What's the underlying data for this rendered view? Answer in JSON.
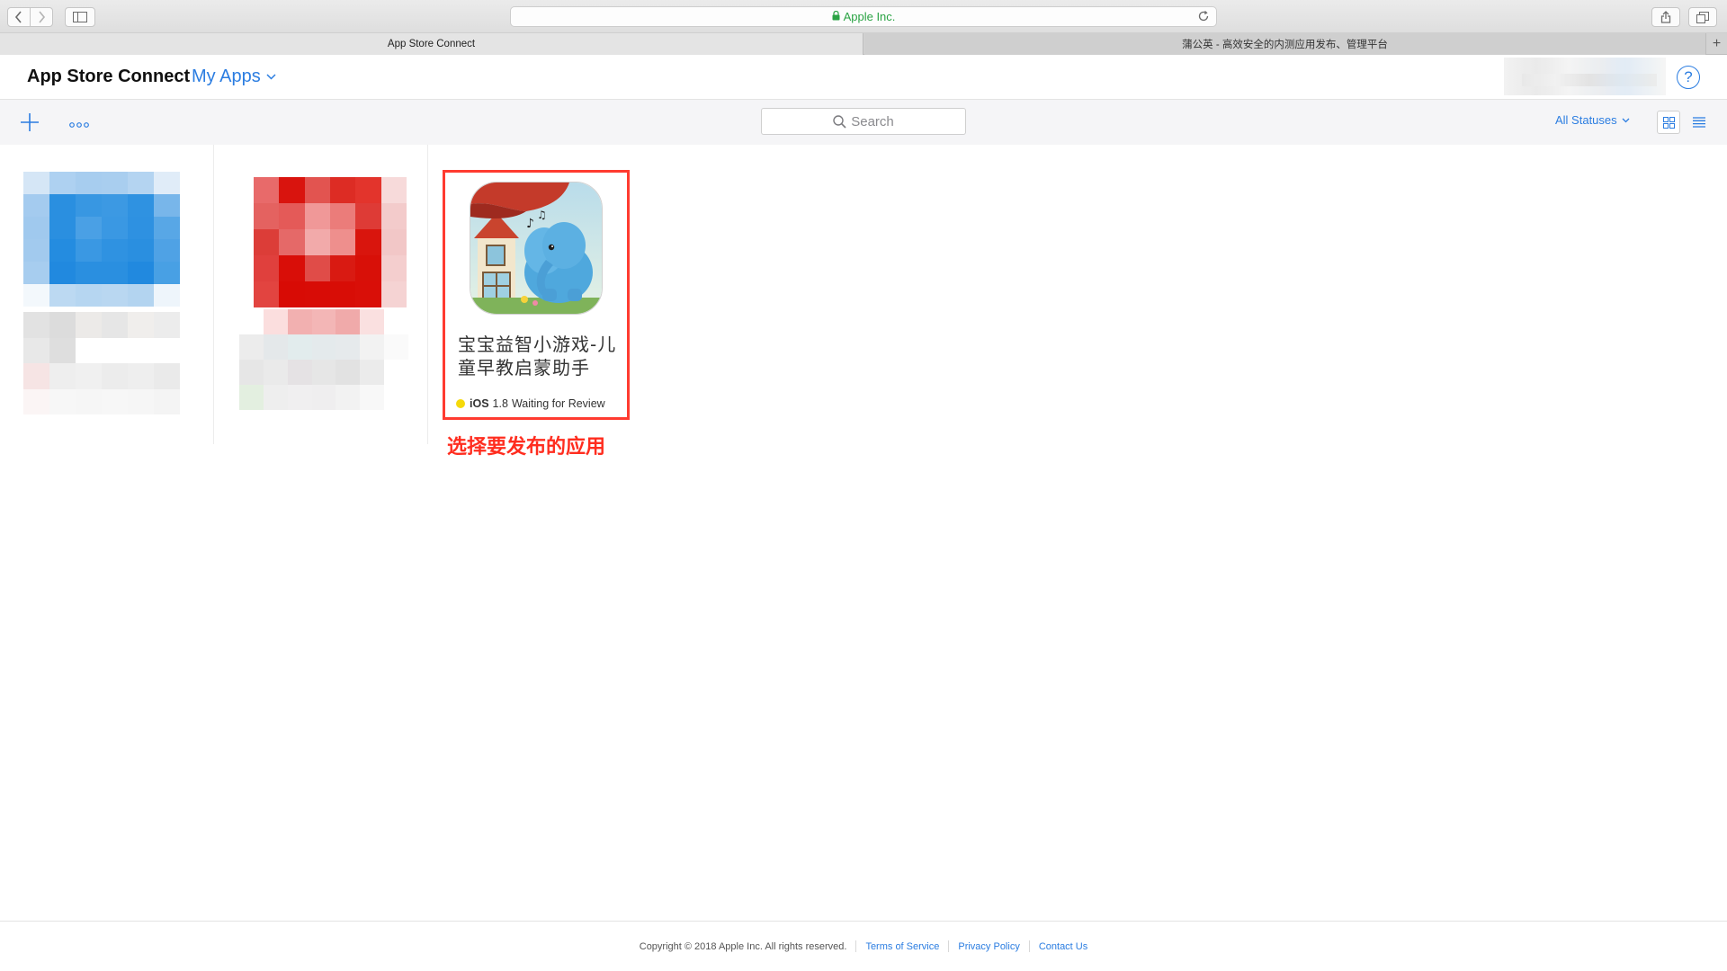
{
  "browser": {
    "address": "Apple Inc.",
    "tabs": [
      {
        "label": "App Store Connect"
      },
      {
        "label": "蒲公英 - 高效安全的内测应用发布、管理平台"
      }
    ],
    "new_tab": "+"
  },
  "header": {
    "brand": "App Store Connect",
    "section": "My Apps",
    "help": "?"
  },
  "subbar": {
    "search_placeholder": "Search",
    "status_filter": "All Statuses"
  },
  "apps": [
    {
      "name": "宝宝益智小游戏-儿童早教启蒙助手",
      "platform": "iOS",
      "version": "1.8",
      "status": "Waiting for Review",
      "status_color": "#f5d90a"
    }
  ],
  "annotation": {
    "caption": "选择要发布的应用",
    "color": "#ff2d1f"
  },
  "footer": {
    "copyright": "Copyright © 2018 Apple Inc. All rights reserved.",
    "links": [
      "Terms of Service",
      "Privacy Policy",
      "Contact Us"
    ]
  },
  "colors": {
    "accent": "#2b7de1",
    "highlight_border": "#ff3b30"
  },
  "icons": [
    "back-icon",
    "forward-icon",
    "sidebar-icon",
    "lock-icon",
    "reload-icon",
    "share-icon",
    "tabs-icon",
    "chevron-down-icon",
    "help-icon",
    "plus-icon",
    "ellipsis-icon",
    "search-icon",
    "grid-view-icon",
    "list-view-icon"
  ]
}
